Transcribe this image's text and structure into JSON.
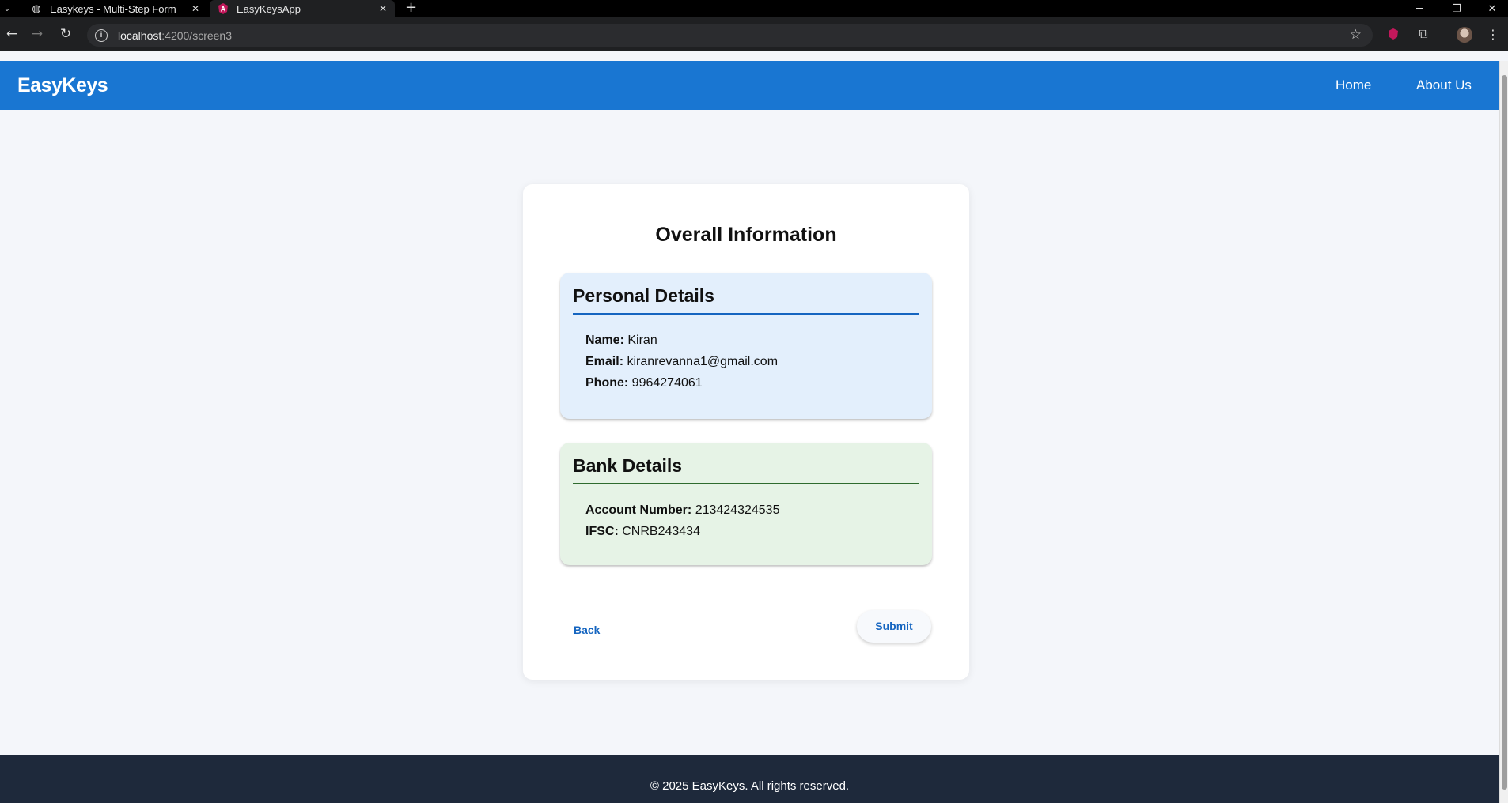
{
  "browser": {
    "tabs": [
      {
        "title": "Easykeys - Multi-Step Form",
        "icon": "globe-icon"
      },
      {
        "title": "EasyKeysApp",
        "icon": "angular-icon"
      }
    ],
    "new_tab": "+",
    "url_host": "localhost",
    "url_path": ":4200/screen3"
  },
  "header": {
    "brand": "EasyKeys",
    "nav": [
      "Home",
      "About Us"
    ],
    "color": "#1976d2"
  },
  "card": {
    "title": "Overall Information",
    "personal": {
      "heading": "Personal Details",
      "name_label": "Name:",
      "name_value": "Kiran",
      "email_label": "Email:",
      "email_value": "kiranrevanna1@gmail.com",
      "phone_label": "Phone:",
      "phone_value": "9964274061"
    },
    "bank": {
      "heading": "Bank Details",
      "account_label": "Account Number:",
      "account_value": "213424324535",
      "ifsc_label": "IFSC:",
      "ifsc_value": "CNRB243434"
    },
    "back_label": "Back",
    "submit_label": "Submit"
  },
  "footer": {
    "text": "© 2025 EasyKeys. All rights reserved."
  }
}
